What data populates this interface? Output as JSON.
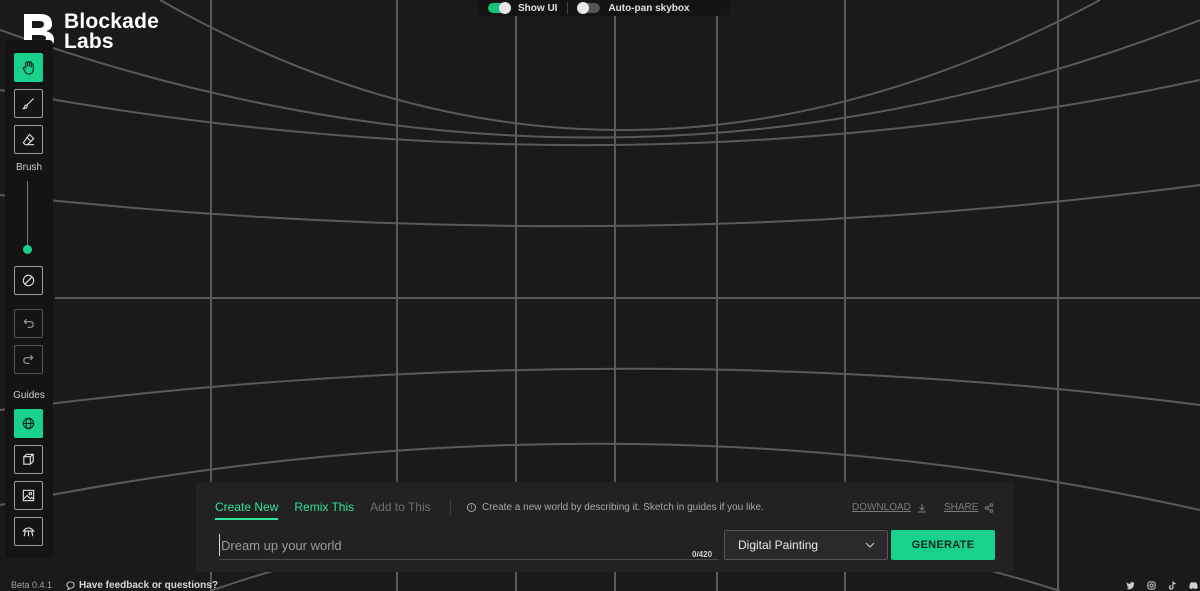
{
  "brand": {
    "line1": "Blockade",
    "line2": "Labs"
  },
  "top_toggles": {
    "show_ui_label": "Show UI",
    "show_ui_on": true,
    "autopan_label": "Auto-pan skybox",
    "autopan_on": false
  },
  "toolbar": {
    "tools": [
      {
        "name": "pan",
        "icon": "hand-icon",
        "active": true
      },
      {
        "name": "brush",
        "icon": "brush-icon",
        "active": false
      },
      {
        "name": "eraser",
        "icon": "eraser-icon",
        "active": false
      }
    ],
    "brush_label": "Brush",
    "brush_size": 0.0,
    "clear_icon": "clear-circle-icon",
    "undo_icon": "undo-icon",
    "redo_icon": "redo-icon",
    "guides_label": "Guides",
    "guides": [
      {
        "name": "globe",
        "icon": "globe-icon",
        "active": true
      },
      {
        "name": "cube",
        "icon": "cube-icon",
        "active": false
      },
      {
        "name": "image",
        "icon": "image-icon",
        "active": false
      },
      {
        "name": "room",
        "icon": "room-icon",
        "active": false
      }
    ]
  },
  "panel": {
    "tabs": [
      {
        "label": "Create New",
        "state": "active"
      },
      {
        "label": "Remix This",
        "state": "green"
      },
      {
        "label": "Add to This",
        "state": "muted"
      }
    ],
    "hint": "Create a new world by describing it. Sketch in guides if you like.",
    "download_label": "DOWNLOAD",
    "share_label": "SHARE",
    "prompt_placeholder": "Dream up your world",
    "prompt_value": "",
    "counter": "0/420",
    "style_value": "Digital Painting",
    "generate_label": "GENERATE"
  },
  "footer": {
    "version": "Beta 0.4.1",
    "feedback": "Have feedback or questions?",
    "socials": [
      "twitter-icon",
      "instagram-icon",
      "tiktok-icon",
      "discord-icon"
    ]
  },
  "colors": {
    "accent": "#18d18a",
    "background": "#1a1a1a",
    "panel": "#222222"
  }
}
